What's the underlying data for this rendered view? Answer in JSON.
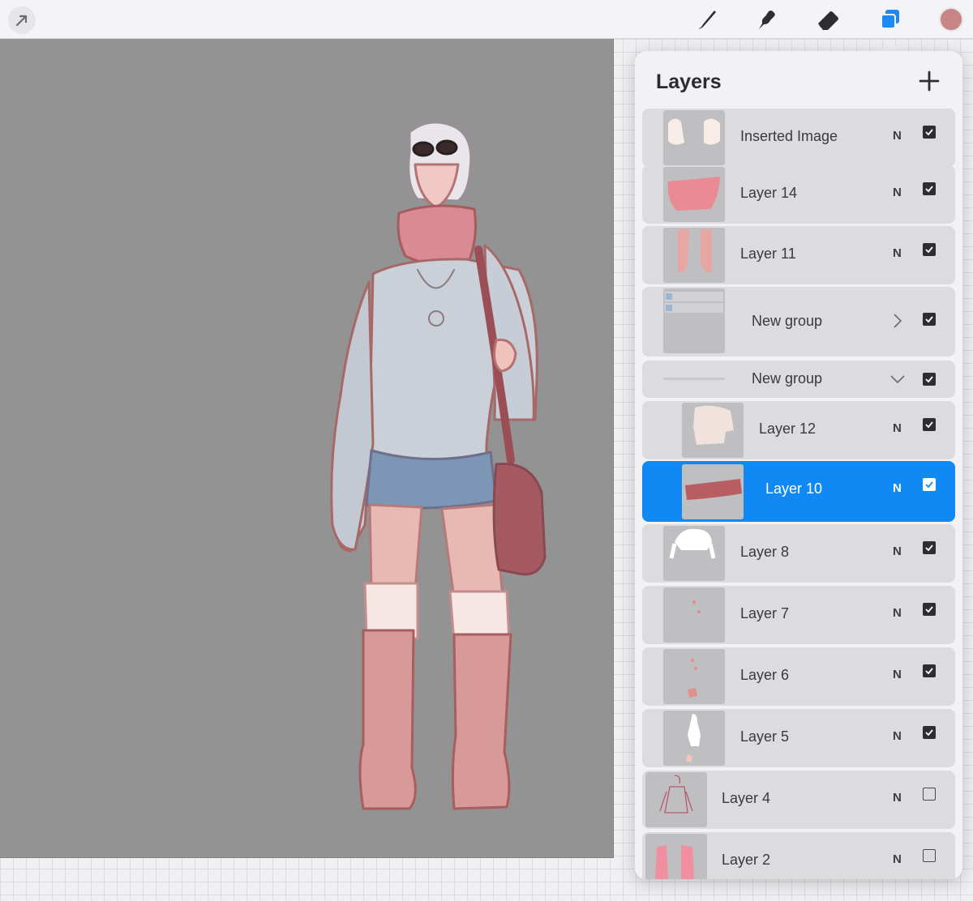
{
  "toolbar": {
    "left_tool_icon": "transform-arrow-icon",
    "tools": [
      "brush-icon",
      "smudge-icon",
      "eraser-icon",
      "layers-icon"
    ],
    "active_tool": "layers-icon",
    "current_color": "#c98585"
  },
  "colors": {
    "canvas_bg": "#939393",
    "selection": "#1089f4",
    "panel_bg": "#f2f2f4"
  },
  "layers_panel": {
    "title": "Layers",
    "add_icon": "plus-icon",
    "layers": [
      {
        "name": "Inserted Image",
        "blend": "N",
        "visible": true,
        "type": "layer"
      },
      {
        "name": "Layer 14",
        "blend": "N",
        "visible": true,
        "type": "layer"
      },
      {
        "name": "Layer 11",
        "blend": "N",
        "visible": true,
        "type": "layer"
      },
      {
        "name": "New group",
        "visible": true,
        "type": "group",
        "expanded": false
      },
      {
        "name": "New group",
        "visible": true,
        "type": "group",
        "expanded": true
      },
      {
        "name": "Layer 12",
        "blend": "N",
        "visible": true,
        "type": "layer",
        "in_group": true
      },
      {
        "name": "Layer 10",
        "blend": "N",
        "visible": true,
        "type": "layer",
        "in_group": true,
        "selected": true
      },
      {
        "name": "Layer 8",
        "blend": "N",
        "visible": true,
        "type": "layer"
      },
      {
        "name": "Layer 7",
        "blend": "N",
        "visible": true,
        "type": "layer"
      },
      {
        "name": "Layer 6",
        "blend": "N",
        "visible": true,
        "type": "layer"
      },
      {
        "name": "Layer 5",
        "blend": "N",
        "visible": true,
        "type": "layer"
      },
      {
        "name": "Layer 4",
        "blend": "N",
        "visible": false,
        "type": "layer"
      },
      {
        "name": "Layer 2",
        "blend": "N",
        "visible": false,
        "type": "layer"
      }
    ]
  }
}
